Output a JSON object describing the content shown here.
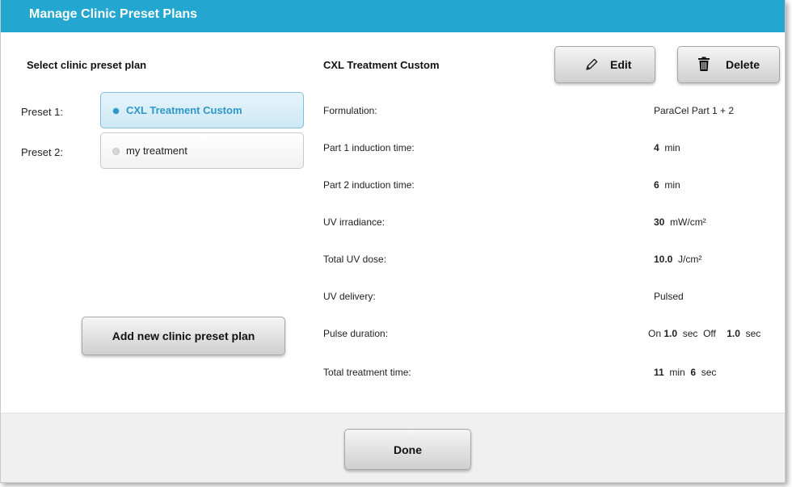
{
  "window": {
    "title": "Manage Clinic Preset Plans"
  },
  "left": {
    "heading": "Select clinic preset plan",
    "presets": [
      {
        "label": "Preset 1:",
        "name": "CXL Treatment Custom",
        "selected": true
      },
      {
        "label": "Preset 2:",
        "name": "my treatment",
        "selected": false
      }
    ],
    "add_button": "Add new clinic preset plan"
  },
  "detail": {
    "plan_name": "CXL Treatment Custom",
    "edit_label": "Edit",
    "delete_label": "Delete",
    "rows": {
      "formulation": {
        "label": "Formulation:",
        "value": "ParaCel Part 1 + 2"
      },
      "part1": {
        "label": "Part 1 induction time:",
        "value": "4",
        "unit": "min"
      },
      "part2": {
        "label": "Part 2 induction time:",
        "value": "6",
        "unit": "min"
      },
      "irradiance": {
        "label": "UV irradiance:",
        "value": "30",
        "unit": "mW/cm²"
      },
      "dose": {
        "label": "Total UV dose:",
        "value": "10.0",
        "unit": "J/cm²"
      },
      "delivery": {
        "label": "UV delivery:",
        "value": "Pulsed"
      },
      "pulse": {
        "label": "Pulse duration:",
        "on_label": "On",
        "on_value": "1.0",
        "on_unit": "sec",
        "off_label": "Off",
        "off_value": "1.0",
        "off_unit": "sec"
      },
      "total": {
        "label": "Total treatment time:",
        "min_value": "11",
        "min_unit": "min",
        "sec_value": "6",
        "sec_unit": "sec"
      }
    }
  },
  "footer": {
    "done_label": "Done"
  },
  "colors": {
    "titlebar": "#23a6cf",
    "selected_text": "#2d97c9"
  },
  "icons": {
    "edit": "pencil-icon",
    "delete": "trash-icon"
  }
}
